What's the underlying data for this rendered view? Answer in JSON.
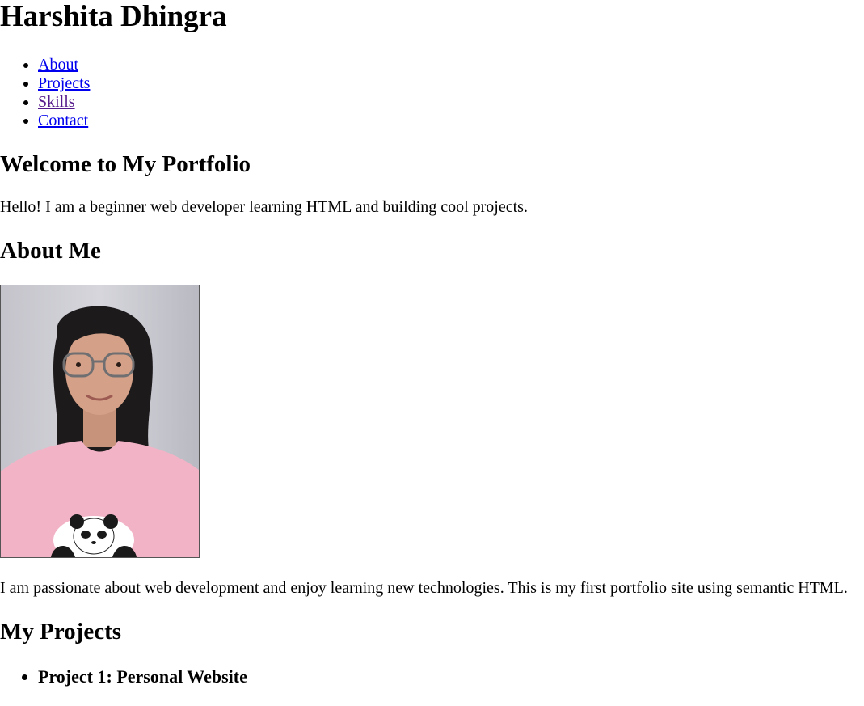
{
  "header": {
    "title": "Harshita Dhingra"
  },
  "nav": {
    "items": [
      {
        "label": "About"
      },
      {
        "label": "Projects"
      },
      {
        "label": "Skills"
      },
      {
        "label": "Contact"
      }
    ]
  },
  "welcome": {
    "heading": "Welcome to My Portfolio",
    "text": "Hello! I am a beginner web developer learning HTML and building cool projects."
  },
  "about": {
    "heading": "About Me",
    "photo_icon": "profile-photo",
    "text": "I am passionate about web development and enjoy learning new technologies. This is my first portfolio site using semantic HTML."
  },
  "projects": {
    "heading": "My Projects",
    "items": [
      {
        "title": "Project 1: Personal Website"
      }
    ]
  },
  "colors": {
    "link": "#0000ee",
    "visited_link": "#551a8b",
    "text": "#000000",
    "background": "#ffffff"
  }
}
